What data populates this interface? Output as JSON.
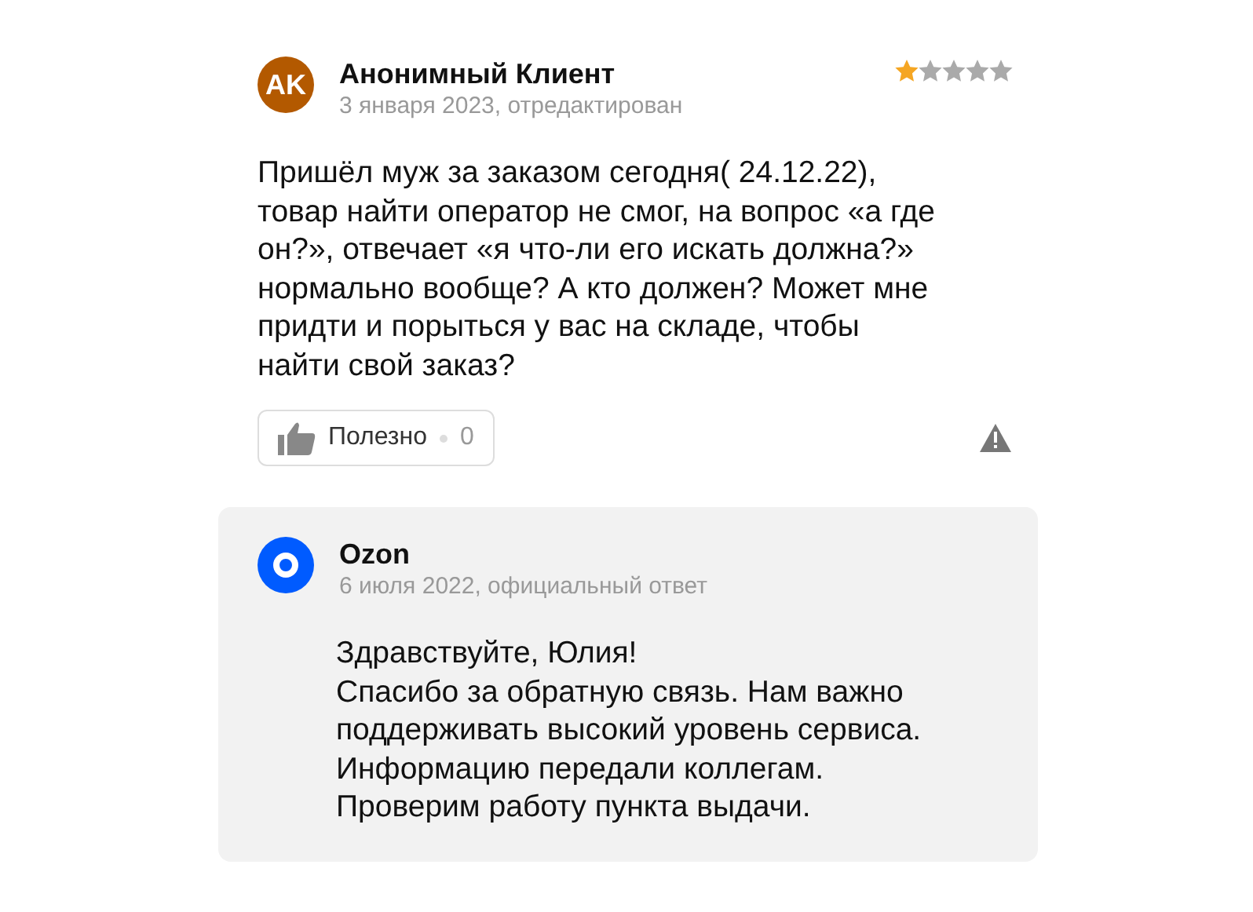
{
  "review": {
    "author": "Анонимный Клиент",
    "avatar_initials": "AK",
    "date": "3 января 2023, отредактирован",
    "stars": 1,
    "text": "Пришёл муж за заказом сегодня( 24.12.22),\nтовар найти оператор не смог, на вопрос «а где\nон?», отвечает «я что-ли его искать должна?»\nнормально вообще? А кто должен? Может мне\nпридти и порыться у вас на складе, чтобы\nнайти свой заказ?",
    "helpful": {
      "label": "Полезно",
      "count": "0"
    }
  },
  "reply": {
    "author": "Ozon",
    "date": "6 июля 2022, официальный ответ",
    "text": "Здравствуйте, Юлия!\nСпасибо за обратную связь. Нам важно\nподдерживать высокий уровень сервиса.\nИнформацию передали коллегам.\nПроверим работу пункта выдачи."
  }
}
